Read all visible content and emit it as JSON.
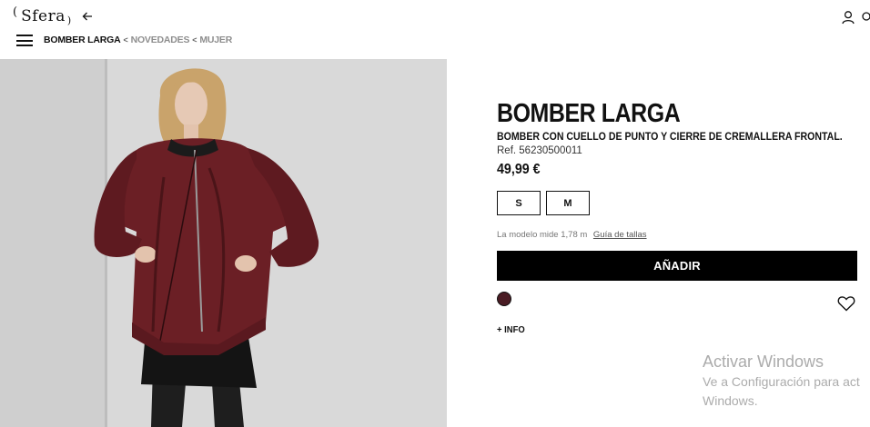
{
  "header": {
    "logo_text": "Sfera",
    "logo_paren_left": "(",
    "logo_paren_right": ")",
    "back_icon": "arrow-left-icon",
    "user_icon": "user-icon",
    "cart_icon": "bag-icon"
  },
  "breadcrumb": {
    "current": "BOMBER LARGA",
    "separator": "<",
    "items": [
      "NOVEDADES",
      "MUJER"
    ]
  },
  "product": {
    "title": "BOMBER LARGA",
    "subtitle": "BOMBER CON CUELLO DE PUNTO Y CIERRE DE CREMALLERA FRONTAL.",
    "ref": "Ref. 56230500011",
    "price": "49,99 €",
    "sizes": [
      "S",
      "M"
    ],
    "model_info": "La modelo mide 1,78 m",
    "size_guide": "Guía de tallas",
    "add_button": "AÑADIR",
    "color_swatch": "#4a1c24",
    "favorite_icon": "heart-icon",
    "more_info": "+ INFO"
  },
  "watermark": {
    "title": "Activar Windows",
    "line1": "Ve a Configuración para act",
    "line2": "Windows."
  }
}
